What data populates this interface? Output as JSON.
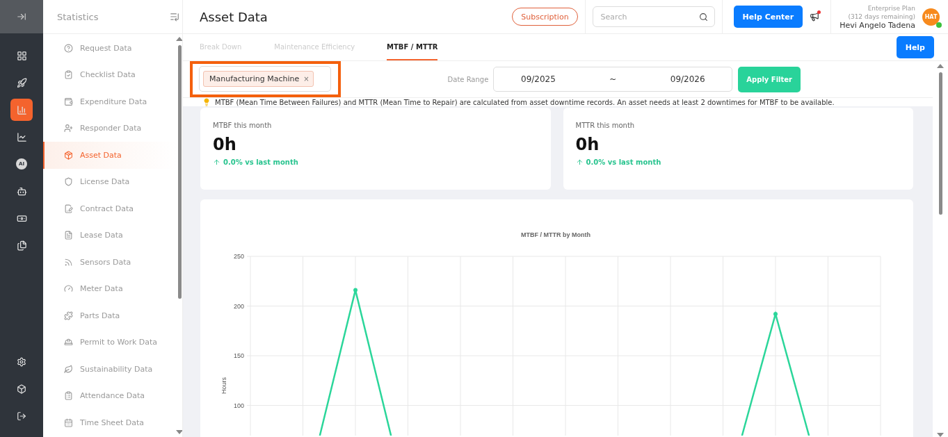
{
  "sidebar": {
    "title": "Statistics",
    "items": [
      {
        "label": "Request Data",
        "selected": false
      },
      {
        "label": "Checklist Data",
        "selected": false
      },
      {
        "label": "Expenditure Data",
        "selected": false
      },
      {
        "label": "Responder Data",
        "selected": false
      },
      {
        "label": "Asset Data",
        "selected": true
      },
      {
        "label": "License Data",
        "selected": false
      },
      {
        "label": "Contract Data",
        "selected": false
      },
      {
        "label": "Lease Data",
        "selected": false
      },
      {
        "label": "Sensors Data",
        "selected": false
      },
      {
        "label": "Meter Data",
        "selected": false
      },
      {
        "label": "Parts Data",
        "selected": false
      },
      {
        "label": "Permit to Work Data",
        "selected": false
      },
      {
        "label": "Sustainability Data",
        "selected": false
      },
      {
        "label": "Attendance Data",
        "selected": false
      },
      {
        "label": "Time Sheet Data",
        "selected": false
      }
    ]
  },
  "rail": {
    "items": [
      {
        "selected": false
      },
      {
        "selected": false
      },
      {
        "selected": true
      },
      {
        "selected": false
      },
      {
        "kind": "badge",
        "label": "AI",
        "selected": false
      },
      {
        "selected": false
      },
      {
        "selected": false
      },
      {
        "selected": false
      }
    ]
  },
  "header": {
    "title": "Asset Data",
    "subscription": "Subscription",
    "search": {
      "placeholder": "Search"
    },
    "help_center": "Help Center",
    "notification": true,
    "plan": "Enterprise Plan",
    "remaining": "(312 days remaining)",
    "user": "Hevi Angelo Tadena",
    "avatar": "HAT",
    "online": true
  },
  "tabs": [
    {
      "label": "Break Down",
      "selected": false
    },
    {
      "label": "Maintenance Efficiency",
      "selected": false
    },
    {
      "label": "MTBF / MTTR",
      "selected": true
    }
  ],
  "help": "Help",
  "filter": {
    "tags": [
      {
        "label": "Manufacturing Machine",
        "remove": "×"
      }
    ],
    "highlighted": true,
    "date_label": "Date Range",
    "from": "09/2025",
    "separator": "~",
    "to": "09/2026",
    "apply": "Apply Filter"
  },
  "info": "MTBF (Mean Time Between Failures) and MTTR (Mean Time to Repair) are calculated from asset downtime records. An asset needs at least 2 downtimes for MTBF to be available.",
  "stats": [
    {
      "label": "MTBF this month",
      "value": "0h",
      "change": "0.0% vs last month"
    },
    {
      "label": "MTTR this month",
      "value": "0h",
      "change": "0.0% vs last month"
    }
  ],
  "chart": {
    "title": "MTBF / MTTR by Month",
    "ylabel": "Hours",
    "tick_labels": [
      "250",
      "200",
      "150",
      "100"
    ]
  }
}
